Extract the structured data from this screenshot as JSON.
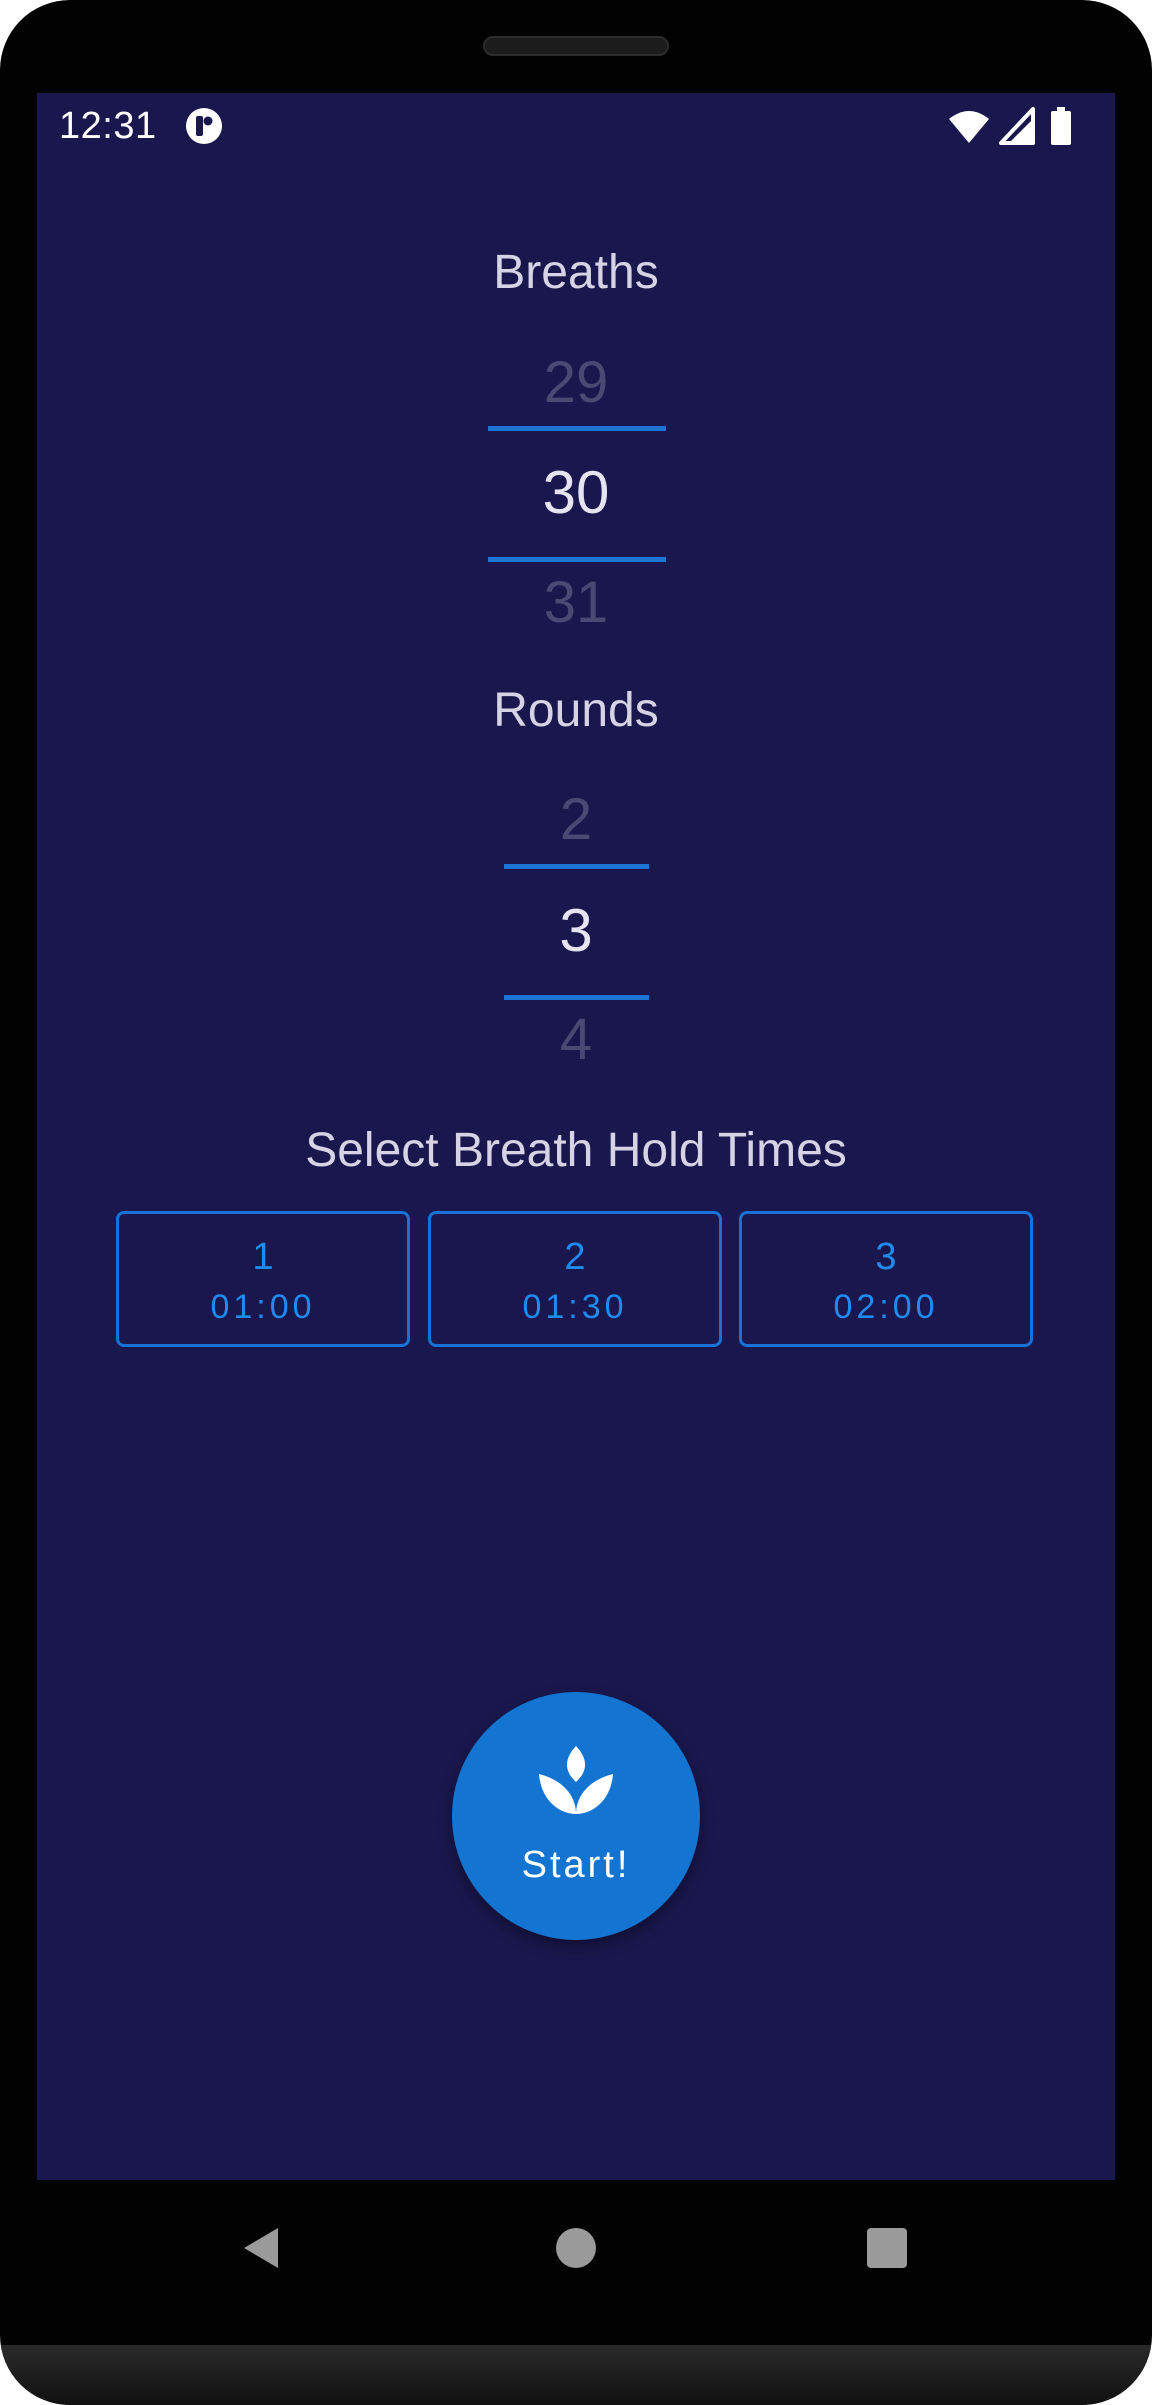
{
  "status_bar": {
    "time": "12:31",
    "icons": [
      "app-notification-icon",
      "wifi-icon",
      "cellular-signal-icon",
      "battery-icon"
    ]
  },
  "breaths": {
    "title": "Breaths",
    "prev": "29",
    "selected": "30",
    "next": "31"
  },
  "rounds": {
    "title": "Rounds",
    "prev": "2",
    "selected": "3",
    "next": "4"
  },
  "hold_times": {
    "title": "Select Breath Hold Times",
    "items": [
      {
        "index": "1",
        "time": "01:00"
      },
      {
        "index": "2",
        "time": "01:30"
      },
      {
        "index": "3",
        "time": "02:00"
      }
    ]
  },
  "start_button": {
    "label": "Start!",
    "icon": "lotus-icon"
  },
  "nav_bar": {
    "icons": [
      "back-icon",
      "home-icon",
      "recents-icon"
    ]
  },
  "colors": {
    "background": "#19174d",
    "accent": "#1375d1",
    "hold_button_text": "#1f8bf0",
    "picker_line": "#1c74d3"
  }
}
